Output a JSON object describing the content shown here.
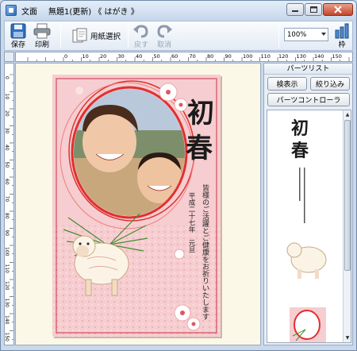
{
  "menu": {
    "file": "文面"
  },
  "window": {
    "document_title": "無題1(更新) 《 はがき 》"
  },
  "toolbar": {
    "save": "保存",
    "print": "印刷",
    "paper_select": "用紙選択",
    "undo": "戻す",
    "redo": "取消",
    "zoom_value": "100%",
    "frame": "枠"
  },
  "ruler": {
    "h_marks": [
      "0",
      "10",
      "20",
      "30",
      "40",
      "50",
      "60",
      "70",
      "80",
      "90",
      "100",
      "110",
      "120",
      "130",
      "140",
      "150"
    ],
    "v_marks": [
      "0",
      "10",
      "20",
      "30",
      "40",
      "50",
      "60",
      "70",
      "80",
      "90",
      "100",
      "110",
      "120",
      "130",
      "140",
      "150"
    ]
  },
  "card": {
    "title_chars": [
      "初",
      "春"
    ],
    "greeting": "皆様のご活躍とご健康をお祈りいたします",
    "date_line": "平成二十七年　元旦"
  },
  "panel": {
    "title": "パーツリスト",
    "table_view_button": "検表示",
    "filter_button": "絞り込み",
    "controller_button": "パーツコントローラ"
  },
  "colors": {
    "window_bg": "#c9d8ea",
    "canvas_bg": "#fbf8e8",
    "card_pink": "#f4c4c7",
    "ring_red": "#e0302f",
    "accent_blue": "#2d6fb8"
  }
}
